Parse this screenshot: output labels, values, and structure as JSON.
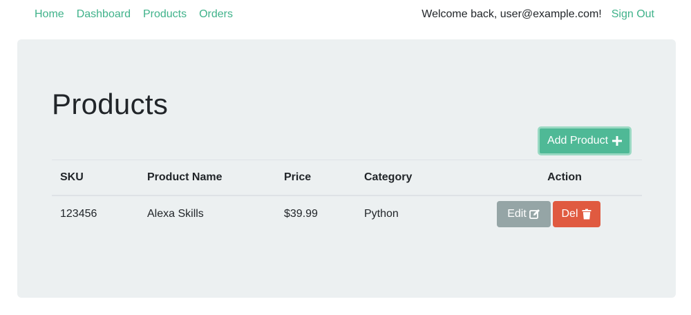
{
  "nav": {
    "links": [
      "Home",
      "Dashboard",
      "Products",
      "Orders"
    ],
    "welcome": "Welcome back, user@example.com!",
    "sign_out": "Sign Out"
  },
  "page": {
    "title": "Products",
    "add_button": "Add Product"
  },
  "table": {
    "headers": [
      "SKU",
      "Product Name",
      "Price",
      "Category",
      "Action"
    ],
    "rows": [
      {
        "sku": "123456",
        "name": "Alexa Skills",
        "price": "$39.99",
        "category": "Python",
        "edit_label": "Edit",
        "del_label": "Del"
      }
    ]
  },
  "icons": {
    "add": "plus-icon",
    "edit": "edit-icon",
    "delete": "trash-icon"
  },
  "colors": {
    "link": "#3fb28a",
    "primary": "#4fb996",
    "secondary": "#95a5a6",
    "danger": "#e05a40",
    "panel": "#ecf0f1"
  }
}
